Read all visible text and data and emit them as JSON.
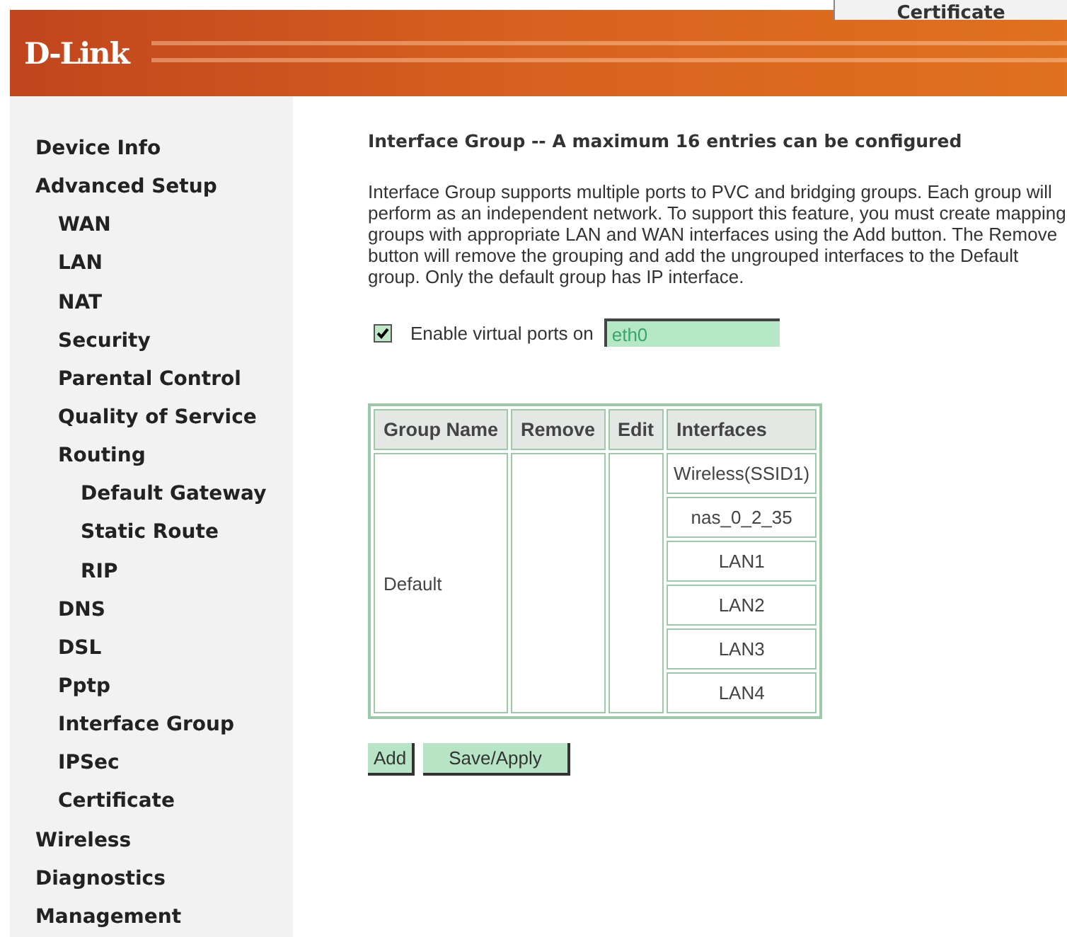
{
  "overlay_fragment": {
    "text": "Certificate"
  },
  "header": {
    "logo": "D-Link"
  },
  "sidebar": {
    "items": [
      {
        "label": "Device Info"
      },
      {
        "label": "Advanced Setup",
        "children": [
          {
            "label": "WAN"
          },
          {
            "label": "LAN"
          },
          {
            "label": "NAT"
          },
          {
            "label": "Security"
          },
          {
            "label": "Parental Control"
          },
          {
            "label": "Quality of Service"
          },
          {
            "label": "Routing",
            "children": [
              {
                "label": "Default Gateway"
              },
              {
                "label": "Static Route"
              },
              {
                "label": "RIP"
              }
            ]
          },
          {
            "label": "DNS"
          },
          {
            "label": "DSL"
          },
          {
            "label": "Pptp"
          },
          {
            "label": "Interface Group"
          },
          {
            "label": "IPSec"
          },
          {
            "label": "Certificate"
          }
        ]
      },
      {
        "label": "Wireless"
      },
      {
        "label": "Diagnostics"
      },
      {
        "label": "Management"
      }
    ]
  },
  "content": {
    "title": "Interface Group -- A maximum 16 entries can be configured",
    "description": "Interface Group supports multiple ports to PVC and bridging groups. Each group will perform as an independent network. To support this feature, you must create mapping groups with appropriate LAN and WAN interfaces using the Add button. The Remove button will remove the grouping and add the ungrouped interfaces to the Default group. Only the default group has IP interface.",
    "virtual_ports": {
      "label": "Enable virtual ports on",
      "checked": true,
      "value": "eth0"
    },
    "table": {
      "columns": [
        "Group Name",
        "Remove",
        "Edit",
        "Interfaces"
      ],
      "rows": [
        {
          "group_name": "Default",
          "interfaces": [
            "Wireless(SSID1)",
            "nas_0_2_35",
            "LAN1",
            "LAN2",
            "LAN3",
            "LAN4"
          ]
        }
      ]
    },
    "buttons": [
      "Add",
      "Save/Apply"
    ]
  }
}
